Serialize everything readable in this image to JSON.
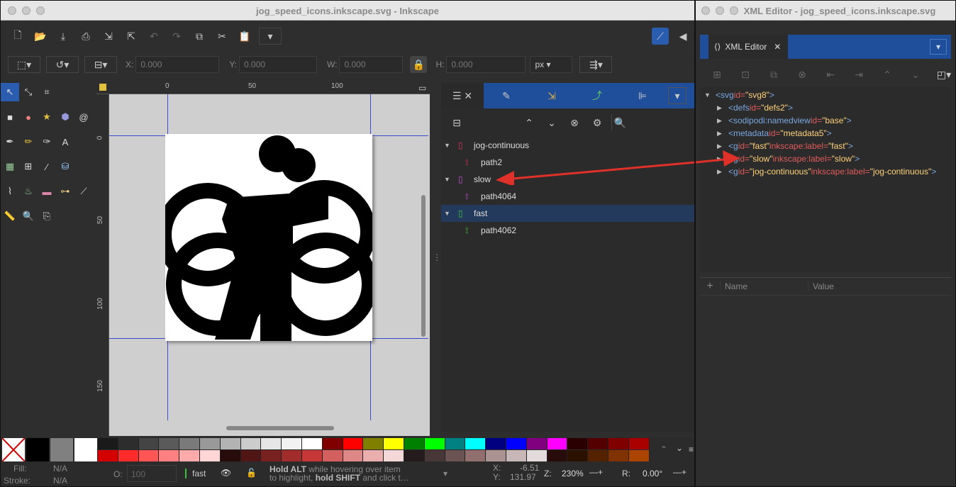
{
  "main_window": {
    "title": "jog_speed_icons.inkscape.svg - Inkscape",
    "toolbar": {
      "x_label": "X:",
      "x_value": "0.000",
      "y_label": "Y:",
      "y_value": "0.000",
      "w_label": "W:",
      "w_value": "0.000",
      "h_label": "H:",
      "h_value": "0.000",
      "unit": "px"
    },
    "ruler_top": [
      "0",
      "50",
      "100"
    ],
    "ruler_left": [
      "0",
      "50",
      "100",
      "150"
    ],
    "layers_panel": {
      "rows": [
        {
          "label": "jog-continuous",
          "kind": "layer",
          "color": "#e0305a"
        },
        {
          "label": "path2",
          "kind": "path",
          "color": "#e0305a"
        },
        {
          "label": "slow",
          "kind": "layer",
          "color": "#c050d0"
        },
        {
          "label": "path4064",
          "kind": "path",
          "color": "#c050d0"
        },
        {
          "label": "fast",
          "kind": "layer",
          "color": "#40c040",
          "selected": true
        },
        {
          "label": "path4062",
          "kind": "path",
          "color": "#40c040"
        }
      ]
    },
    "status": {
      "fill_label": "Fill:",
      "fill_value": "N/A",
      "stroke_label": "Stroke:",
      "stroke_value": "N/A",
      "opacity_label": "O:",
      "opacity_value": "100",
      "layer": "fast",
      "hint_line1_bold": "Hold ALT",
      "hint_line1": " while hovering over item",
      "hint_line2_pre": "to highlight, ",
      "hint_line2_bold": "hold SHIFT",
      "hint_line2_post": " and click t…",
      "x_label": "X:",
      "x_value": "-6.51",
      "y_label": "Y:",
      "y_value": "131.97",
      "z_label": "Z:",
      "zoom": "230%",
      "r_label": "R:",
      "rotation": "0.00°"
    },
    "palette_top": [
      "#1a1a1a",
      "#2d2d2d",
      "#444",
      "#5a5a5a",
      "#7a7a7a",
      "#999",
      "#b3b3b3",
      "#ccc",
      "#e6e6e6",
      "#f2f2f2",
      "#fff",
      "#800000",
      "#ff0000",
      "#808000",
      "#ffff00",
      "#008000",
      "#00ff00",
      "#008080",
      "#00ffff",
      "#000080",
      "#0000ff",
      "#800080",
      "#ff00ff",
      "#2b0000",
      "#550000",
      "#800000",
      "#aa0000"
    ],
    "palette_bottom": [
      "#d40000",
      "#ff2a2a",
      "#ff5555",
      "#ff8080",
      "#ffaaaa",
      "#ffd5d5",
      "#280b0b",
      "#501616",
      "#782121",
      "#a02c2c",
      "#c83737",
      "#d35f5f",
      "#de8787",
      "#e9afaf",
      "#f4d7d7",
      "#241c1c",
      "#483737",
      "#6c5353",
      "#916f6f",
      "#ac9393",
      "#c8b7b7",
      "#e3dbdb",
      "#280b0b",
      "#2b1100",
      "#552200",
      "#803300",
      "#aa4400"
    ]
  },
  "xml_window": {
    "title": "XML Editor - jog_speed_icons.inkscape.svg",
    "tab": "XML Editor",
    "nodes": [
      {
        "indent": 0,
        "arrow": "▼",
        "tag": "svg",
        "attrs": [
          [
            "id",
            "svg8"
          ]
        ]
      },
      {
        "indent": 1,
        "arrow": "▶",
        "tag": "defs",
        "attrs": [
          [
            "id",
            "defs2"
          ]
        ]
      },
      {
        "indent": 1,
        "arrow": "▶",
        "tag": "sodipodi:namedview",
        "attrs": [
          [
            "id",
            "base"
          ]
        ]
      },
      {
        "indent": 1,
        "arrow": "▶",
        "tag": "metadata",
        "attrs": [
          [
            "id",
            "metadata5"
          ]
        ]
      },
      {
        "indent": 1,
        "arrow": "▶",
        "tag": "g",
        "attrs": [
          [
            "id",
            "fast"
          ],
          [
            "inkscape:label",
            "fast"
          ]
        ]
      },
      {
        "indent": 1,
        "arrow": "▶",
        "tag": "g",
        "attrs": [
          [
            "id",
            "slow"
          ],
          [
            "inkscape:label",
            "slow"
          ]
        ]
      },
      {
        "indent": 1,
        "arrow": "▶",
        "tag": "g",
        "attrs": [
          [
            "id",
            "jog-continuous"
          ],
          [
            "inkscape:label",
            "jog-continuous"
          ]
        ]
      }
    ],
    "attr_headers": {
      "name": "Name",
      "value": "Value"
    }
  }
}
